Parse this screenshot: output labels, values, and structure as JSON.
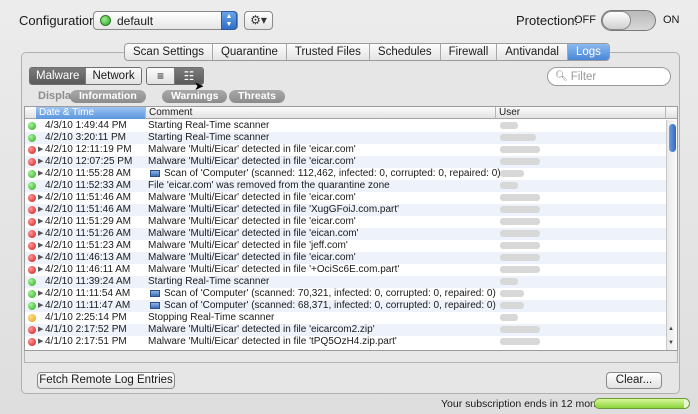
{
  "header": {
    "configuration_label": "Configuration:",
    "configuration_value": "default",
    "protection_label": "Protection:",
    "off_label": "OFF",
    "on_label": "ON",
    "protection_on": false
  },
  "tabs": [
    "Scan Settings",
    "Quarantine",
    "Trusted Files",
    "Schedules",
    "Firewall",
    "Antivandal",
    "Logs"
  ],
  "active_tab": "Logs",
  "log_type": {
    "items": [
      "Malware",
      "Network"
    ],
    "active": "Malware"
  },
  "view_mode_icons": [
    "list-view-icon",
    "detail-list-view-icon"
  ],
  "filter": {
    "placeholder": "Filter",
    "value": ""
  },
  "display": {
    "label": "Display:",
    "pills": [
      "Information",
      "Warnings",
      "Threats"
    ]
  },
  "table": {
    "columns": [
      "Date & Time",
      "Comment",
      "User"
    ],
    "sorted_column": "Date & Time",
    "rows": [
      {
        "status": "green",
        "disclosure": false,
        "date": "4/3/10 1:49:44 PM",
        "comment": "Starting Real-Time scanner",
        "scan": false
      },
      {
        "status": "green",
        "disclosure": false,
        "date": "4/2/10 3:20:11 PM",
        "comment": "Starting Real-Time scanner",
        "scan": false
      },
      {
        "status": "red",
        "disclosure": true,
        "date": "4/2/10 12:11:19 PM",
        "comment": "Malware 'Multi/Eicar' detected in file 'eicar.com'",
        "scan": false
      },
      {
        "status": "red",
        "disclosure": true,
        "date": "4/2/10 12:07:25 PM",
        "comment": "Malware 'Multi/Eicar' detected in file 'eicar.com'",
        "scan": false
      },
      {
        "status": "green",
        "disclosure": true,
        "date": "4/2/10 11:55:28 AM",
        "comment": "Scan of 'Computer' (scanned: 112,462, infected: 0, corrupted: 0, repaired: 0)",
        "scan": true
      },
      {
        "status": "green",
        "disclosure": false,
        "date": "4/2/10 11:52:33 AM",
        "comment": "File 'eicar.com' was removed from the quarantine zone",
        "scan": false
      },
      {
        "status": "red",
        "disclosure": true,
        "date": "4/2/10 11:51:46 AM",
        "comment": "Malware 'Multi/Eicar' detected in file 'eicar.com'",
        "scan": false
      },
      {
        "status": "red",
        "disclosure": true,
        "date": "4/2/10 11:51:46 AM",
        "comment": "Malware 'Multi/Eicar' detected in file 'XugGFoiJ.com.part'",
        "scan": false
      },
      {
        "status": "red",
        "disclosure": true,
        "date": "4/2/10 11:51:29 AM",
        "comment": "Malware 'Multi/Eicar' detected in file 'eicar.com'",
        "scan": false
      },
      {
        "status": "red",
        "disclosure": true,
        "date": "4/2/10 11:51:26 AM",
        "comment": "Malware 'Multi/Eicar' detected in file 'eican.com'",
        "scan": false
      },
      {
        "status": "red",
        "disclosure": true,
        "date": "4/2/10 11:51:23 AM",
        "comment": "Malware 'Multi/Eicar' detected in file 'jeff.com'",
        "scan": false
      },
      {
        "status": "red",
        "disclosure": true,
        "date": "4/2/10 11:46:13 AM",
        "comment": "Malware 'Multi/Eicar' detected in file 'eicar.com'",
        "scan": false
      },
      {
        "status": "red",
        "disclosure": true,
        "date": "4/2/10 11:46:11 AM",
        "comment": "Malware 'Multi/Eicar' detected in file '+OciSc6E.com.part'",
        "scan": false
      },
      {
        "status": "green",
        "disclosure": false,
        "date": "4/2/10 11:39:24 AM",
        "comment": "Starting Real-Time scanner",
        "scan": false
      },
      {
        "status": "green",
        "disclosure": true,
        "date": "4/2/10 11:11:54 AM",
        "comment": "Scan of 'Computer' (scanned: 70,321, infected: 0, corrupted: 0, repaired: 0)",
        "scan": true
      },
      {
        "status": "green",
        "disclosure": true,
        "date": "4/2/10 11:11:47 AM",
        "comment": "Scan of 'Computer' (scanned: 68,371, infected: 0, corrupted: 0, repaired: 0)",
        "scan": true
      },
      {
        "status": "orange",
        "disclosure": false,
        "date": "4/1/10 2:25:14 PM",
        "comment": "Stopping Real-Time scanner",
        "scan": false
      },
      {
        "status": "red",
        "disclosure": true,
        "date": "4/1/10 2:17:52 PM",
        "comment": "Malware 'Multi/Eicar' detected in file 'eicarcom2.zip'",
        "scan": false
      },
      {
        "status": "red",
        "disclosure": true,
        "date": "4/1/10 2:17:51 PM",
        "comment": "Malware 'Multi/Eicar' detected in file 'tPQ5OzH4.zip.part'",
        "scan": false
      }
    ]
  },
  "buttons": {
    "fetch": "Fetch Remote Log Entries",
    "clear": "Clear..."
  },
  "subscription": {
    "text": "Your subscription ends in 12 months",
    "remaining_fraction": 0.95
  },
  "colors": {
    "accent": "#4a87d8",
    "threat": "#cc1a1a",
    "ok": "#2da624",
    "warning": "#e89b10"
  }
}
